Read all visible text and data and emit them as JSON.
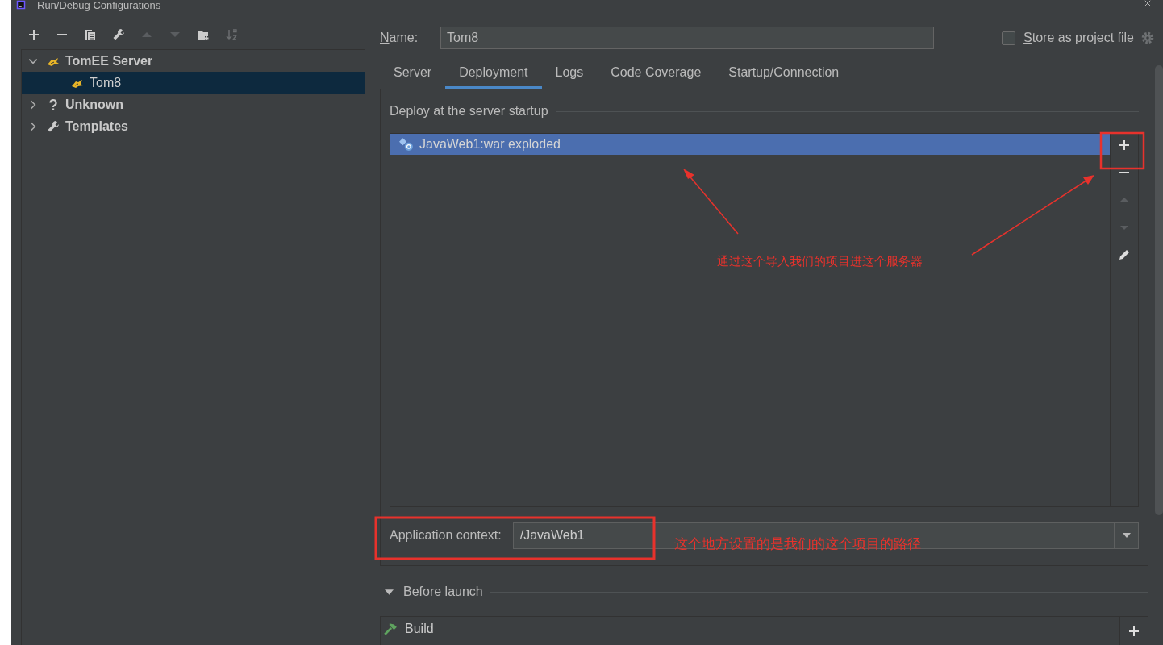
{
  "window": {
    "title": "Run/Debug Configurations"
  },
  "tree": [
    {
      "label": "TomEE Server",
      "kind": "tomcat",
      "expanded": true,
      "selected": false,
      "children": [
        {
          "label": "Tom8",
          "kind": "tomcat",
          "selected": true
        }
      ]
    },
    {
      "label": "Unknown",
      "kind": "unknown",
      "expanded": false,
      "selected": false
    },
    {
      "label": "Templates",
      "kind": "wrench",
      "expanded": false,
      "selected": false
    }
  ],
  "name_field": {
    "label": "Name:",
    "value": "Tom8"
  },
  "store_option": {
    "label": "Store as project file",
    "checked": false
  },
  "tabs": [
    {
      "label": "Server",
      "selected": false
    },
    {
      "label": "Deployment",
      "selected": true
    },
    {
      "label": "Logs",
      "selected": false
    },
    {
      "label": "Code Coverage",
      "selected": false
    },
    {
      "label": "Startup/Connection",
      "selected": false
    }
  ],
  "deployment": {
    "title": "Deploy at the server startup",
    "items": [
      {
        "label": "JavaWeb1:war exploded",
        "selected": true
      }
    ]
  },
  "application_context": {
    "label": "Application context:",
    "value": "/JavaWeb1"
  },
  "before_launch": {
    "title": "Before launch",
    "expanded": true,
    "tasks": [
      {
        "label": "Build"
      }
    ]
  },
  "annotations": [
    {
      "text": "通过这个导入我们的项目进这个服务器"
    },
    {
      "text": "这个地方设置的是我们的这个项目的路径"
    }
  ]
}
